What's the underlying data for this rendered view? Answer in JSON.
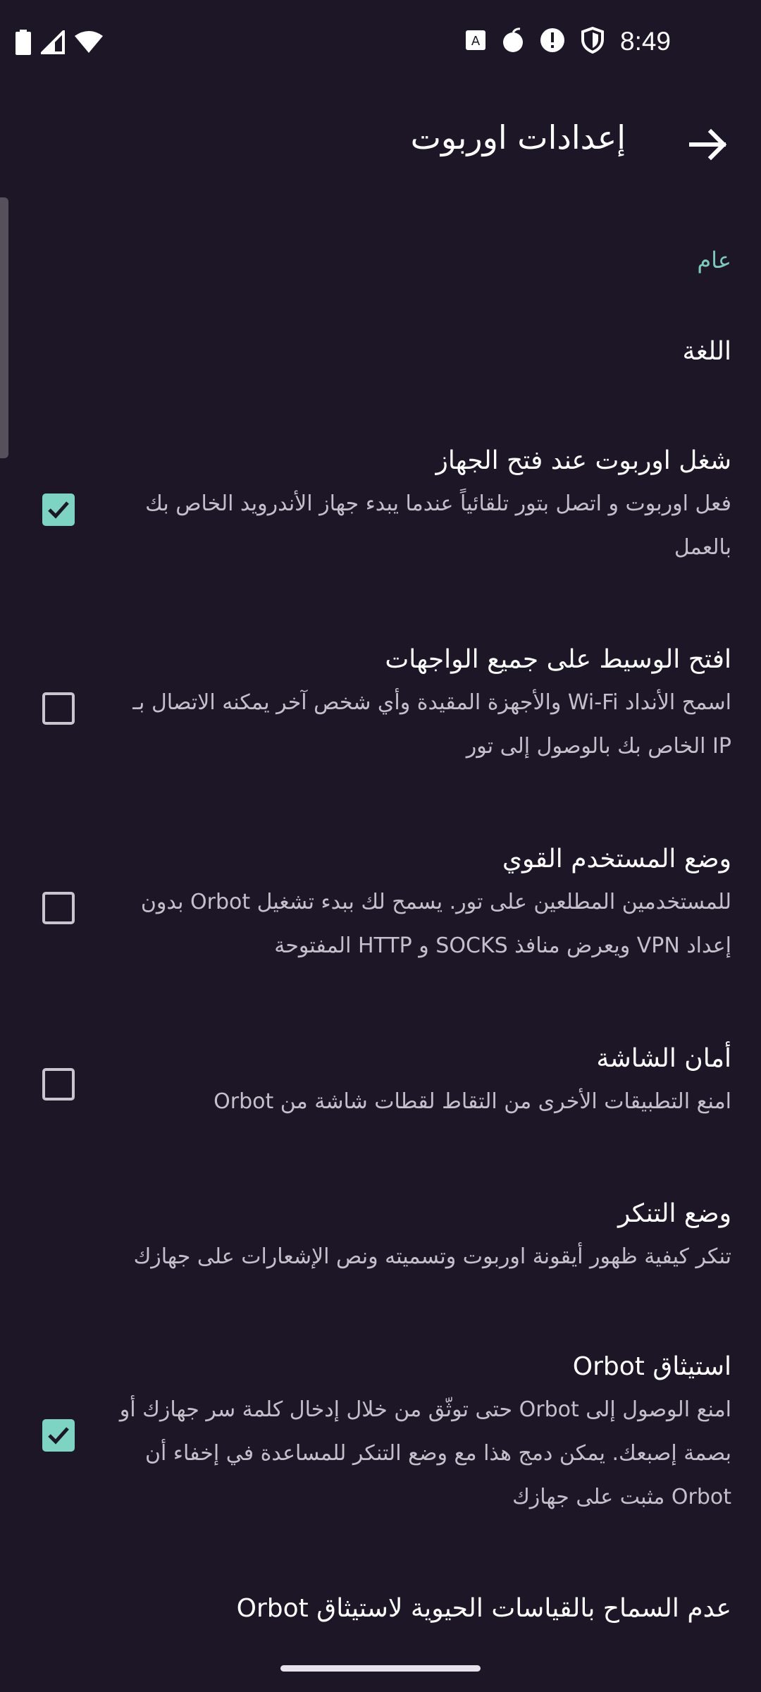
{
  "status_bar": {
    "time": "8:49",
    "icons": [
      "battery-icon",
      "signal-icon",
      "wifi-icon",
      "app-notification-icon",
      "bomb-icon",
      "alert-icon",
      "shield-icon"
    ]
  },
  "toolbar": {
    "title": "إعدادات اوربوت",
    "back_icon": "arrow-right-icon"
  },
  "category": "عام",
  "prefs": [
    {
      "title": "اللغة",
      "summary": ""
    },
    {
      "title": "شغل اوربوت عند فتح الجهاز",
      "summary": "فعل اوربوت و اتصل بتور تلقائياً عندما يبدء جهاز الأندرويد الخاص بك بالعمل",
      "checked": true
    },
    {
      "title": "افتح الوسيط على جميع الواجهات",
      "summary": "اسمح الأنداد Wi-Fi والأجهزة المقيدة وأي شخص آخر يمكنه الاتصال بـ IP الخاص بك بالوصول إلى تور",
      "checked": false
    },
    {
      "title": "وضع المستخدم القوي",
      "summary": "للمستخدمين المطلعين على تور. يسمح لك ببدء تشغيل Orbot بدون إعداد VPN ويعرض منافذ SOCKS و HTTP المفتوحة",
      "checked": false
    },
    {
      "title": "أمان الشاشة",
      "summary": "امنع التطبيقات الأخرى من التقاط لقطات شاشة من Orbot",
      "checked": false
    },
    {
      "title": "وضع التنكر",
      "summary": "تنكر كيفية ظهور أيقونة اوربوت وتسميته ونص الإشعارات على جهازك"
    },
    {
      "title": "استيثاق Orbot",
      "summary": "امنع الوصول إلى Orbot حتى توثّق من خلال إدخال كلمة سر جهازك أو بصمة إصبعك. يمكن دمج هذا مع وضع التنكر للمساعدة في إخفاء أن Orbot مثبت على جهازك",
      "checked": true
    },
    {
      "title": "عدم السماح بالقياسات الحيوية لاستيثاق Orbot",
      "summary": ""
    }
  ],
  "colors": {
    "background": "#1c1626",
    "accent": "#7ed4c2",
    "category": "#7bcab9",
    "summary_text": "#c4bfca"
  }
}
